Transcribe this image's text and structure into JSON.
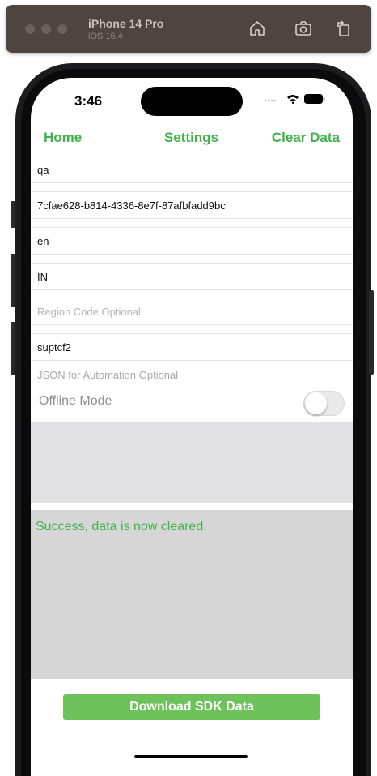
{
  "simulator": {
    "device_name": "iPhone 14 Pro",
    "os_version": "iOS 16.4",
    "icons": [
      "home-icon",
      "screenshot-icon",
      "rotate-icon"
    ]
  },
  "status_bar": {
    "time": "3:46"
  },
  "nav": {
    "home": "Home",
    "settings": "Settings",
    "clear": "Clear Data"
  },
  "fields": {
    "env": "qa",
    "id": "7cfae628-b814-4336-8e7f-87afbfadd9bc",
    "language": "en",
    "country": "IN",
    "region_placeholder": "Region Code Optional",
    "user": "suptcf2",
    "json_placeholder": "JSON for Automation Optional"
  },
  "offline": {
    "label": "Offline Mode",
    "enabled": false
  },
  "message": "Success, data is now cleared.",
  "download_button": "Download SDK Data",
  "colors": {
    "accent": "#3fb24a",
    "button": "#6ec25b",
    "panel": "#d6d6d6"
  }
}
